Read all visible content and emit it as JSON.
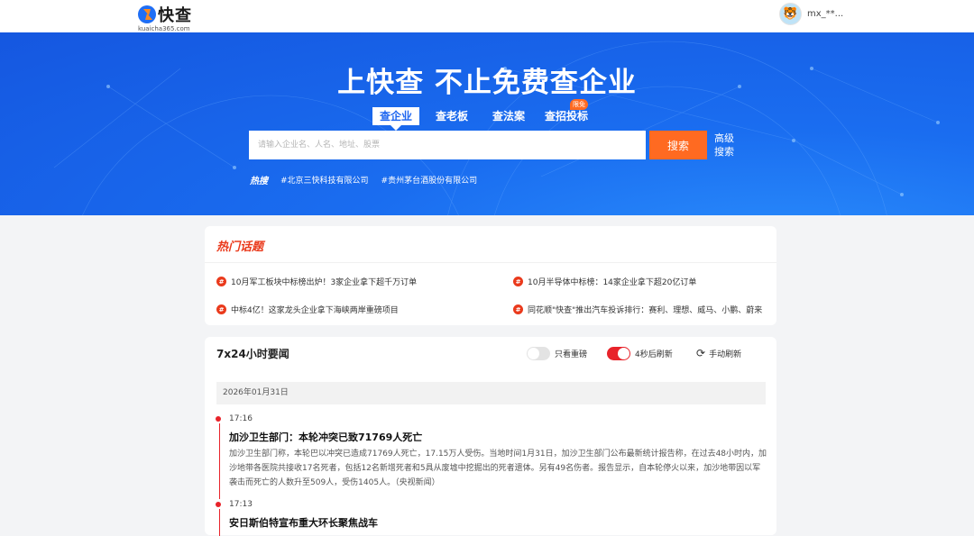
{
  "header": {
    "logo_text": "快查",
    "logo_sub": "kuaicha365.com",
    "username": "mx_**..."
  },
  "hero": {
    "title": "上快查 不止免费查企业",
    "tabs": [
      {
        "label": "查企业"
      },
      {
        "label": "查老板"
      },
      {
        "label": "查法案"
      },
      {
        "label": "查招投标"
      }
    ],
    "badge": "限免",
    "search_placeholder": "请输入企业名、人名、地址、股票",
    "search_button": "搜索",
    "advanced": "高级搜索",
    "hot_label": "热搜",
    "hot_items": [
      "#北京三快科技有限公司",
      "#贵州茅台酒股份有限公司"
    ]
  },
  "topics": {
    "title": "热门话题",
    "items": [
      "10月军工板块中标榜出炉！3家企业拿下超千万订单",
      "10月半导体中标榜：14家企业拿下超20亿订单",
      "中标4亿！这家龙头企业拿下海峡两岸重磅项目",
      "同花顺\"快查\"推出汽车投诉排行：赛利、理想、威马、小鹏、蔚来"
    ]
  },
  "news": {
    "title": "7x24小时要闻",
    "toggle_heavy": "只看重磅",
    "toggle_auto": "4秒后刷新",
    "manual_refresh": "手动刷新",
    "date": "2026年01月31日",
    "entries": [
      {
        "time": "17:16",
        "headline": "加沙卫生部门：本轮冲突已致71769人死亡",
        "body": "加沙卫生部门称，本轮巴以冲突已造成71769人死亡，17.15万人受伤。当地时间1月31日，加沙卫生部门公布最新统计报告称，在过去48小时内，加沙地带各医院共接收17名死者，包括12名新增死者和5具从废墟中挖掘出的死者遗体。另有49名伤者。报告显示，自本轮停火以来，加沙地带因以军袭击而死亡的人数升至509人，受伤1405人。（央视新闻）"
      },
      {
        "time": "17:13",
        "headline": "安日斯伯特宣布重大环长聚焦战车"
      }
    ]
  },
  "colors": {
    "brand_blue": "#1a63ee",
    "accent_orange": "#ff6a21",
    "hot_red": "#ea3a1c"
  }
}
